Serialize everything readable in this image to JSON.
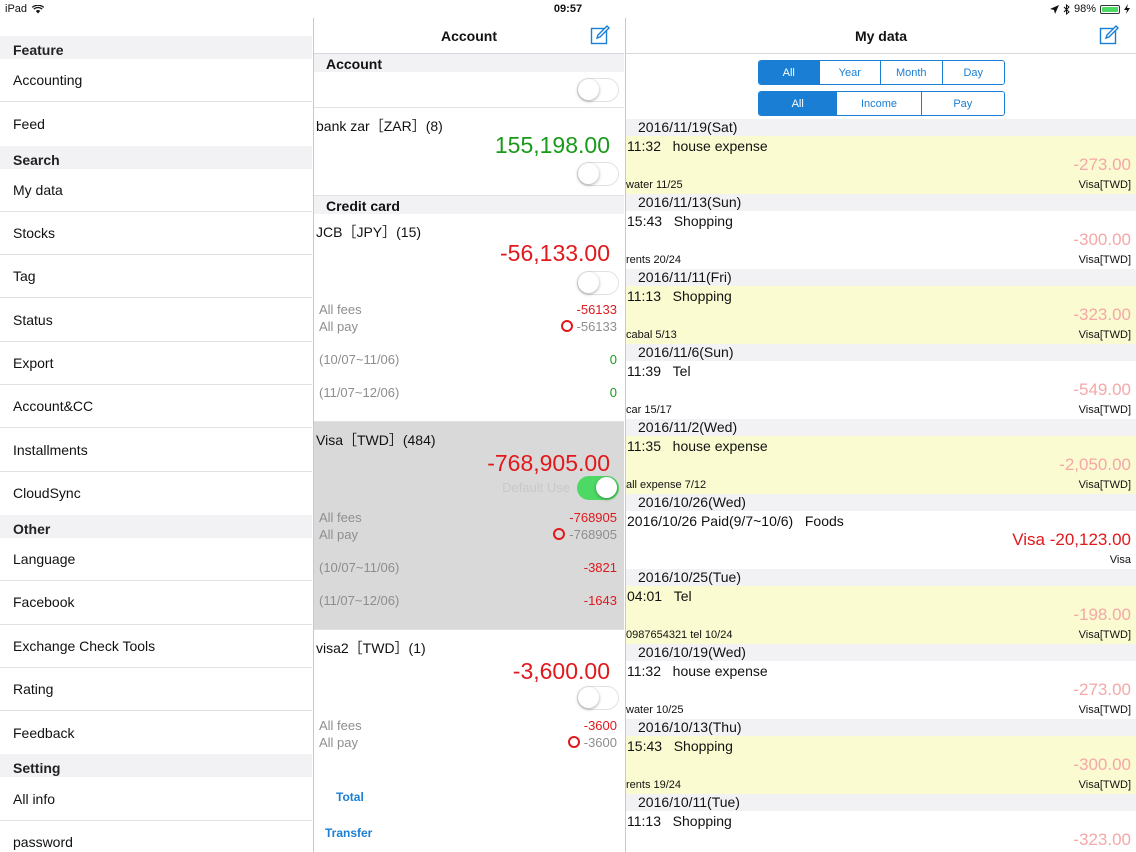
{
  "status_bar": {
    "device": "iPad",
    "time": "09:57",
    "battery": "98%",
    "battery_level": 0.98
  },
  "sidebar": {
    "sections": [
      {
        "header": "Feature",
        "items": [
          "Accounting",
          "Feed"
        ]
      },
      {
        "header": "Search",
        "items": [
          "My data",
          "Stocks",
          "Tag",
          "Status",
          "Export",
          "Account&CC",
          "Installments",
          "CloudSync"
        ]
      },
      {
        "header": "Other",
        "items": [
          "Language",
          "Facebook",
          "Exchange Check Tools",
          "Rating",
          "Feedback"
        ]
      },
      {
        "header": "Setting",
        "items": [
          "All info",
          "password"
        ]
      }
    ]
  },
  "account_pane": {
    "title": "Account",
    "sections": {
      "account": "Account",
      "credit_card": "Credit card"
    },
    "bank": {
      "name": "bank zar［ZAR］(8)",
      "balance": "155,198.00"
    },
    "jcb": {
      "name": "JCB［JPY］(15)",
      "balance": "-56,133.00",
      "all_fees_label": "All fees",
      "all_fees": "-56133",
      "all_pay_label": "All pay",
      "all_pay": "-56133",
      "period1_label": "(10/07~11/06)",
      "period1": "0",
      "period2_label": "(11/07~12/06)",
      "period2": "0"
    },
    "visa": {
      "name": "Visa［TWD］(484)",
      "balance": "-768,905.00",
      "default_use": "Default Use",
      "all_fees_label": "All fees",
      "all_fees": "-768905",
      "all_pay_label": "All pay",
      "all_pay": "-768905",
      "period1_label": "(10/07~11/06)",
      "period1": "-3821",
      "period2_label": "(11/07~12/06)",
      "period2": "-1643"
    },
    "visa2": {
      "name": "visa2［TWD］(1)",
      "balance": "-3,600.00",
      "all_fees_label": "All fees",
      "all_fees": "-3600",
      "all_pay_label": "All pay",
      "all_pay": "-3600"
    },
    "total_label": "Total",
    "transfer_label": "Transfer"
  },
  "mydata_pane": {
    "title": "My data",
    "period_tabs": [
      "All",
      "Year",
      "Month",
      "Day"
    ],
    "type_tabs": [
      "All",
      "Income",
      "Pay"
    ],
    "groups": [
      {
        "date": "2016/11/19(Sat)",
        "time": "11:32",
        "desc": "house expense",
        "amount": "-273.00",
        "note": "water 11/25",
        "card": "Visa[TWD]"
      },
      {
        "date": "2016/11/13(Sun)",
        "time": "15:43",
        "desc": "Shopping",
        "amount": "-300.00",
        "note": "rents 20/24",
        "card": "Visa[TWD]"
      },
      {
        "date": "2016/11/11(Fri)",
        "time": "11:13",
        "desc": "Shopping",
        "amount": "-323.00",
        "note": "cabal 5/13",
        "card": "Visa[TWD]"
      },
      {
        "date": "2016/11/6(Sun)",
        "time": "11:39",
        "desc": "Tel",
        "amount": "-549.00",
        "note": "car 15/17",
        "card": "Visa[TWD]"
      },
      {
        "date": "2016/11/2(Wed)",
        "time": "11:35",
        "desc": "house expense",
        "amount": "-2,050.00",
        "note": "all expense 7/12",
        "card": "Visa[TWD]"
      },
      {
        "date": "2016/10/26(Wed)",
        "time": "2016/10/26 Paid(9/7~10/6)",
        "desc": "Foods",
        "amount": "Visa -20,123.00",
        "note": "",
        "card": "Visa"
      },
      {
        "date": "2016/10/25(Tue)",
        "time": "04:01",
        "desc": "Tel",
        "amount": "-198.00",
        "note": "0987654321 tel 10/24",
        "card": "Visa[TWD]"
      },
      {
        "date": "2016/10/19(Wed)",
        "time": "11:32",
        "desc": "house expense",
        "amount": "-273.00",
        "note": "water 10/25",
        "card": "Visa[TWD]"
      },
      {
        "date": "2016/10/13(Thu)",
        "time": "15:43",
        "desc": "Shopping",
        "amount": "-300.00",
        "note": "rents 19/24",
        "card": "Visa[TWD]"
      },
      {
        "date": "2016/10/11(Tue)",
        "time": "11:13",
        "desc": "Shopping",
        "amount": "-323.00",
        "note": "",
        "card": ""
      }
    ]
  }
}
